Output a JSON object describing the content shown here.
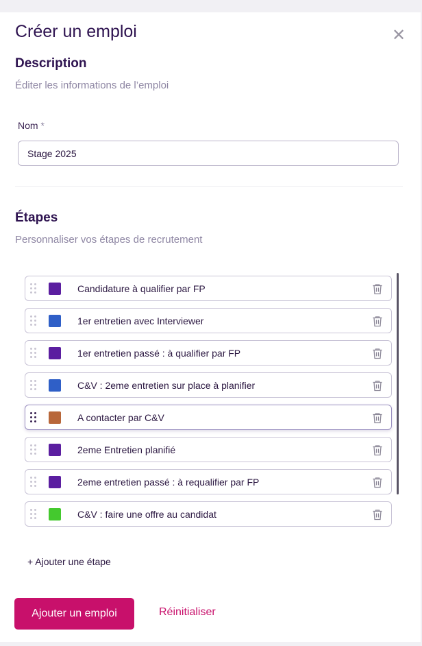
{
  "dialog": {
    "title": "Créer un emploi",
    "close_icon": "close-icon"
  },
  "description": {
    "heading": "Description",
    "subheading": "Éditer les informations de l’emploi"
  },
  "name_field": {
    "label": "Nom",
    "required_mark": "*",
    "value": "Stage 2025"
  },
  "steps_section": {
    "heading": "Étapes",
    "subheading": "Personnaliser vos étapes de recrutement",
    "items": [
      {
        "label": "Candidature à qualifier par FP",
        "color": "#5b1ea0"
      },
      {
        "label": "1er entretien avec Interviewer",
        "color": "#2f5fc7"
      },
      {
        "label": "1er entretien passé : à qualifier par FP",
        "color": "#5b1ea0"
      },
      {
        "label": "C&V : 2eme entretien sur place à planifier",
        "color": "#2f5fc7"
      },
      {
        "label": "A contacter par C&V",
        "color": "#b8673a"
      },
      {
        "label": "2eme Entretien planifié",
        "color": "#5b1ea0"
      },
      {
        "label": "2eme entretien passé : à requalifier par FP",
        "color": "#5b1ea0"
      },
      {
        "label": "C&V : faire une offre au candidat",
        "color": "#44c92e"
      }
    ],
    "add_label": "+ Ajouter une étape"
  },
  "actions": {
    "submit_label": "Ajouter un emploi",
    "reset_label": "Réinitialiser",
    "primary_color": "#c8106b"
  }
}
